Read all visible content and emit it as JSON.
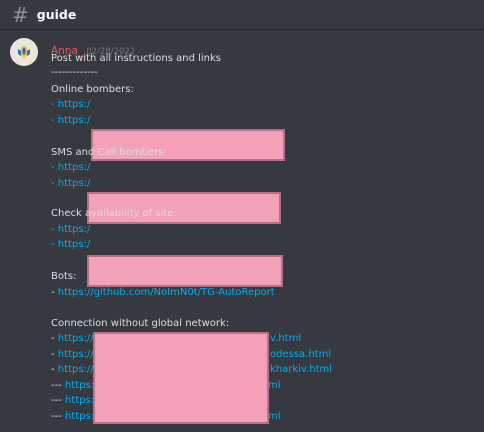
{
  "channel": {
    "icon": "hashtag-icon",
    "name": "guide"
  },
  "message": {
    "author": "Anna_",
    "timestamp": "02/28/2022",
    "title": "Post with all instructions and links",
    "divider": "-------------",
    "sections": {
      "online": {
        "heading": "Online bombers:",
        "lines": [
          "- https:/",
          "- https:/"
        ]
      },
      "sms": {
        "heading": "SMS and Call bombers:",
        "lines": [
          "- https:/",
          "- https:/"
        ]
      },
      "check": {
        "heading": "Check availability of site:",
        "lines": [
          "-  https:/",
          "- https:/"
        ]
      },
      "bots": {
        "heading": "Bots:",
        "prefix": "- ",
        "link": "https://github.com/NoImN0t/TG-AutoReport"
      },
      "connection": {
        "heading": "Connection without global network:",
        "lines": [
          {
            "prefix": "- ",
            "start": "https://",
            "end": "v.html"
          },
          {
            "prefix": "- ",
            "start": "https://",
            "end": "odessa.html"
          },
          {
            "prefix": "- ",
            "start": "https://",
            "end": "kharkiv.html"
          },
          {
            "prefix": "--- ",
            "start": "https:/",
            "end": "ml"
          },
          {
            "prefix": "--- ",
            "start": "https:/",
            "end": ""
          },
          {
            "prefix": "--- ",
            "start": "https:/",
            "end": "ml"
          }
        ]
      }
    }
  },
  "colors": {
    "background": "#36393f",
    "link": "#00aff4",
    "username": "#e65a5a",
    "redaction": "#f4a0b8"
  }
}
